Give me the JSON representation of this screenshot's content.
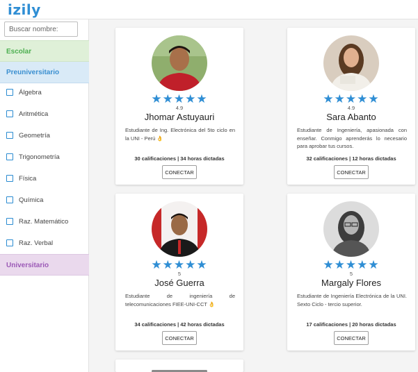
{
  "app": {
    "logo": "izily"
  },
  "sidebar": {
    "search_placeholder": "Buscar nombre:",
    "sections": {
      "escolar": "Escolar",
      "preuniversitario": "Preuniversitario",
      "universitario": "Universitario"
    },
    "categories": [
      "Álgebra",
      "Aritmética",
      "Geometría",
      "Trigonometría",
      "Física",
      "Química",
      "Raz. Matemático",
      "Raz. Verbal"
    ]
  },
  "stars": "★★★★★",
  "tutors": [
    {
      "name": "Jhomar Astuyauri",
      "rating": "4.9",
      "description": "Estudiante de Ing. Electrónica del 5to ciclo en la UNI - Perú 👌",
      "stats": "30 calificaciones | 34 horas dictadas",
      "button": "CONECTAR"
    },
    {
      "name": "Sara Abanto",
      "rating": "4.9",
      "description": "Estudiante de Ingeniería, apasionada con enseñar. Conmigo aprenderás lo necesario para aprobar tus cursos.",
      "stats": "32 calificaciones | 12 horas dictadas",
      "button": "CONECTAR"
    },
    {
      "name": "José Guerra",
      "rating": "5",
      "description": "Estudiante de ingeniería de telecomunicaciones FIEE-UNI-CCT 👌",
      "stats": "34 calificaciones | 42 horas dictadas",
      "button": "CONECTAR"
    },
    {
      "name": "Margaly Flores",
      "rating": "5",
      "description": "Estudiante de Ingeniería Electrónica de la UNI. Sexto Ciclo - tercio superior.",
      "stats": "17 calificaciones | 20 horas dictadas",
      "button": "CONECTAR"
    }
  ]
}
